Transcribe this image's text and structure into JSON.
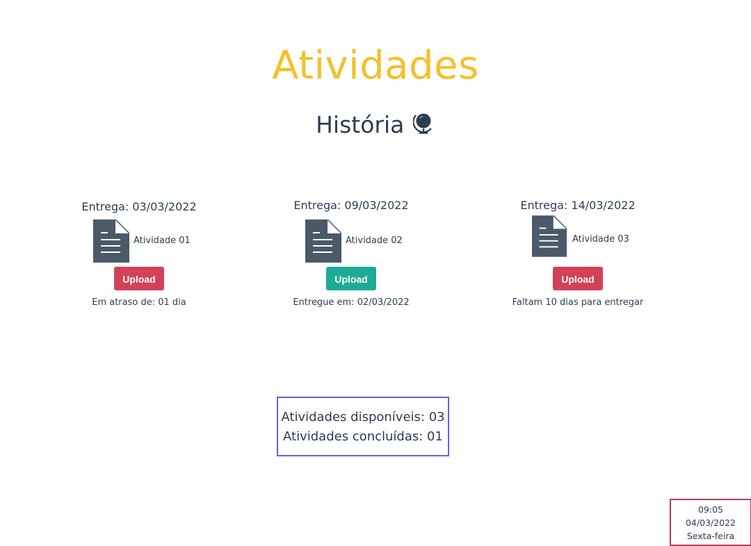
{
  "page": {
    "title": "Atividades"
  },
  "subject": {
    "name": "História",
    "icon": "globe-icon"
  },
  "activities": [
    {
      "due": "Entrega: 03/03/2022",
      "name": "Atividade 01",
      "icon": "document-icon",
      "upload_label": "Upload",
      "upload_color": "#d24158",
      "status": "Em atraso de: 01 dia"
    },
    {
      "due": "Entrega: 09/03/2022",
      "name": "Atividade 02",
      "icon": "document-icon",
      "upload_label": "Upload",
      "upload_color": "#1eab96",
      "status": "Entregue em: 02/03/2022"
    },
    {
      "due": "Entrega: 14/03/2022",
      "name": "Atividade 03",
      "icon": "document-icon",
      "upload_label": "Upload",
      "upload_color": "#d24158",
      "status": "Faltam 10 dias para entregar"
    }
  ],
  "summary": {
    "available": "Atividades disponíveis: 03",
    "completed": "Atividades concluídas: 01",
    "border_color": "#6a5ce6"
  },
  "clock": {
    "time": "09:05",
    "date": "04/03/2022",
    "weekday": "Sexta-feira",
    "border_color": "#b53a55"
  },
  "colors": {
    "title": "#f4c02a",
    "text": "#2c3e50",
    "icon": "#4a5a68"
  }
}
